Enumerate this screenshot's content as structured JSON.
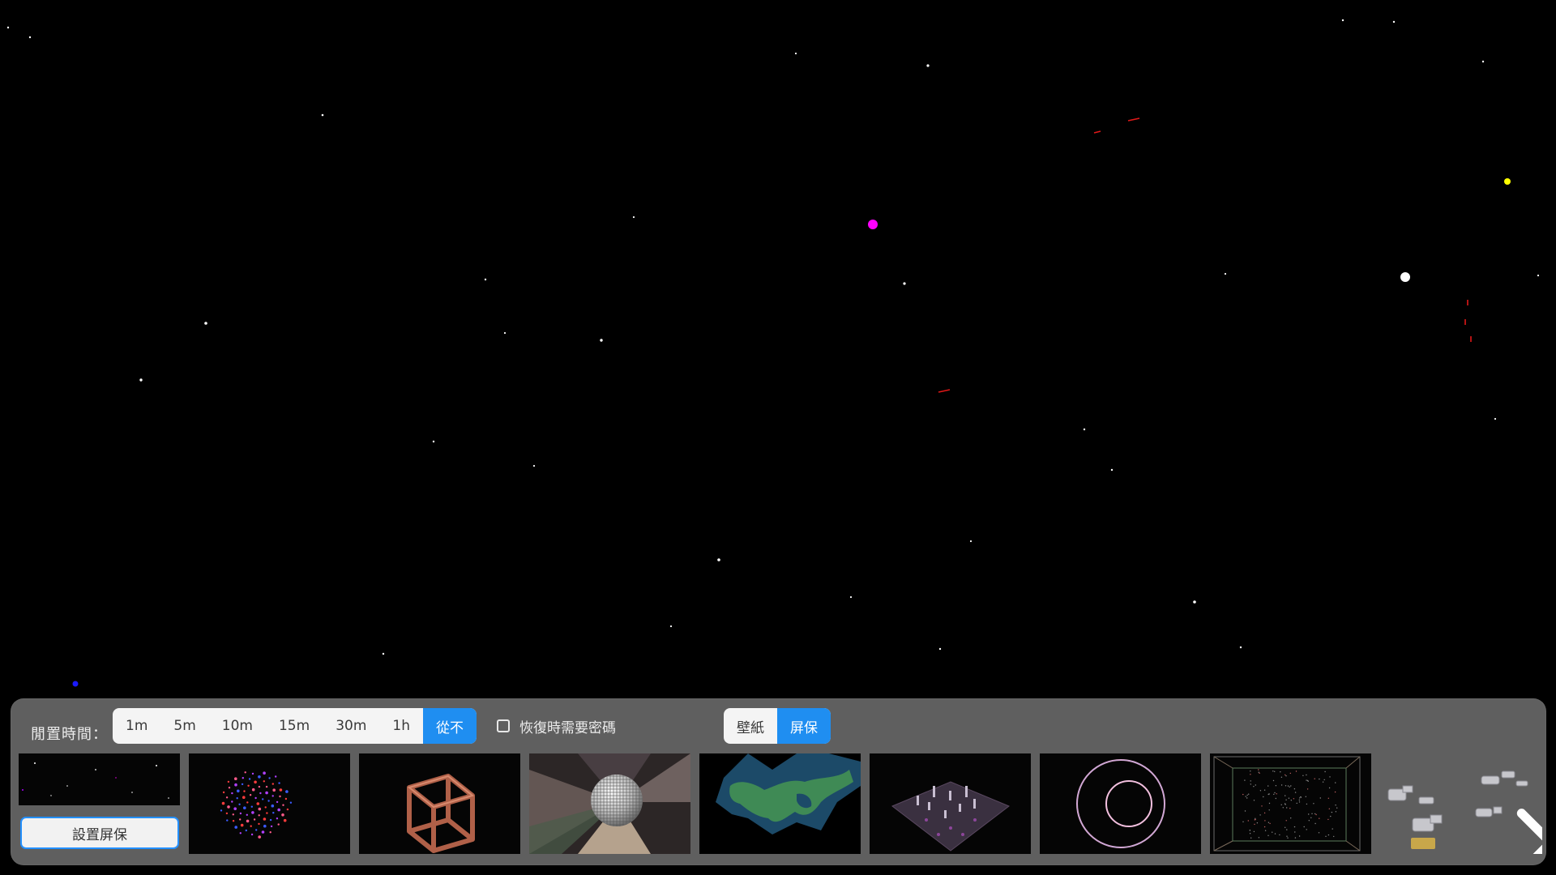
{
  "colors": {
    "background": "#000000",
    "panel": "#5f5f5f",
    "accent": "#1f8ef1",
    "segment": "#f4f4f4"
  },
  "settings": {
    "idle_label": "閒置時間：",
    "time_options": [
      "1m",
      "5m",
      "10m",
      "15m",
      "30m",
      "1h",
      "從不"
    ],
    "selected_time": "從不",
    "password_label": "恢復時需要密碼",
    "password_checked": false,
    "mode_options": [
      "壁紙",
      "屏保"
    ],
    "selected_mode": "屏保",
    "set_button": "設置屏保"
  },
  "screensavers": [
    {
      "icon": "starfield-thumbnail"
    },
    {
      "icon": "particle-sphere-thumbnail"
    },
    {
      "icon": "wire-cube-thumbnail"
    },
    {
      "icon": "disco-ball-thumbnail"
    },
    {
      "icon": "world-map-thumbnail"
    },
    {
      "icon": "chess-board-thumbnail"
    },
    {
      "icon": "circles-thumbnail"
    },
    {
      "icon": "particle-box-thumbnail"
    },
    {
      "icon": "spaceships-thumbnail"
    }
  ]
}
